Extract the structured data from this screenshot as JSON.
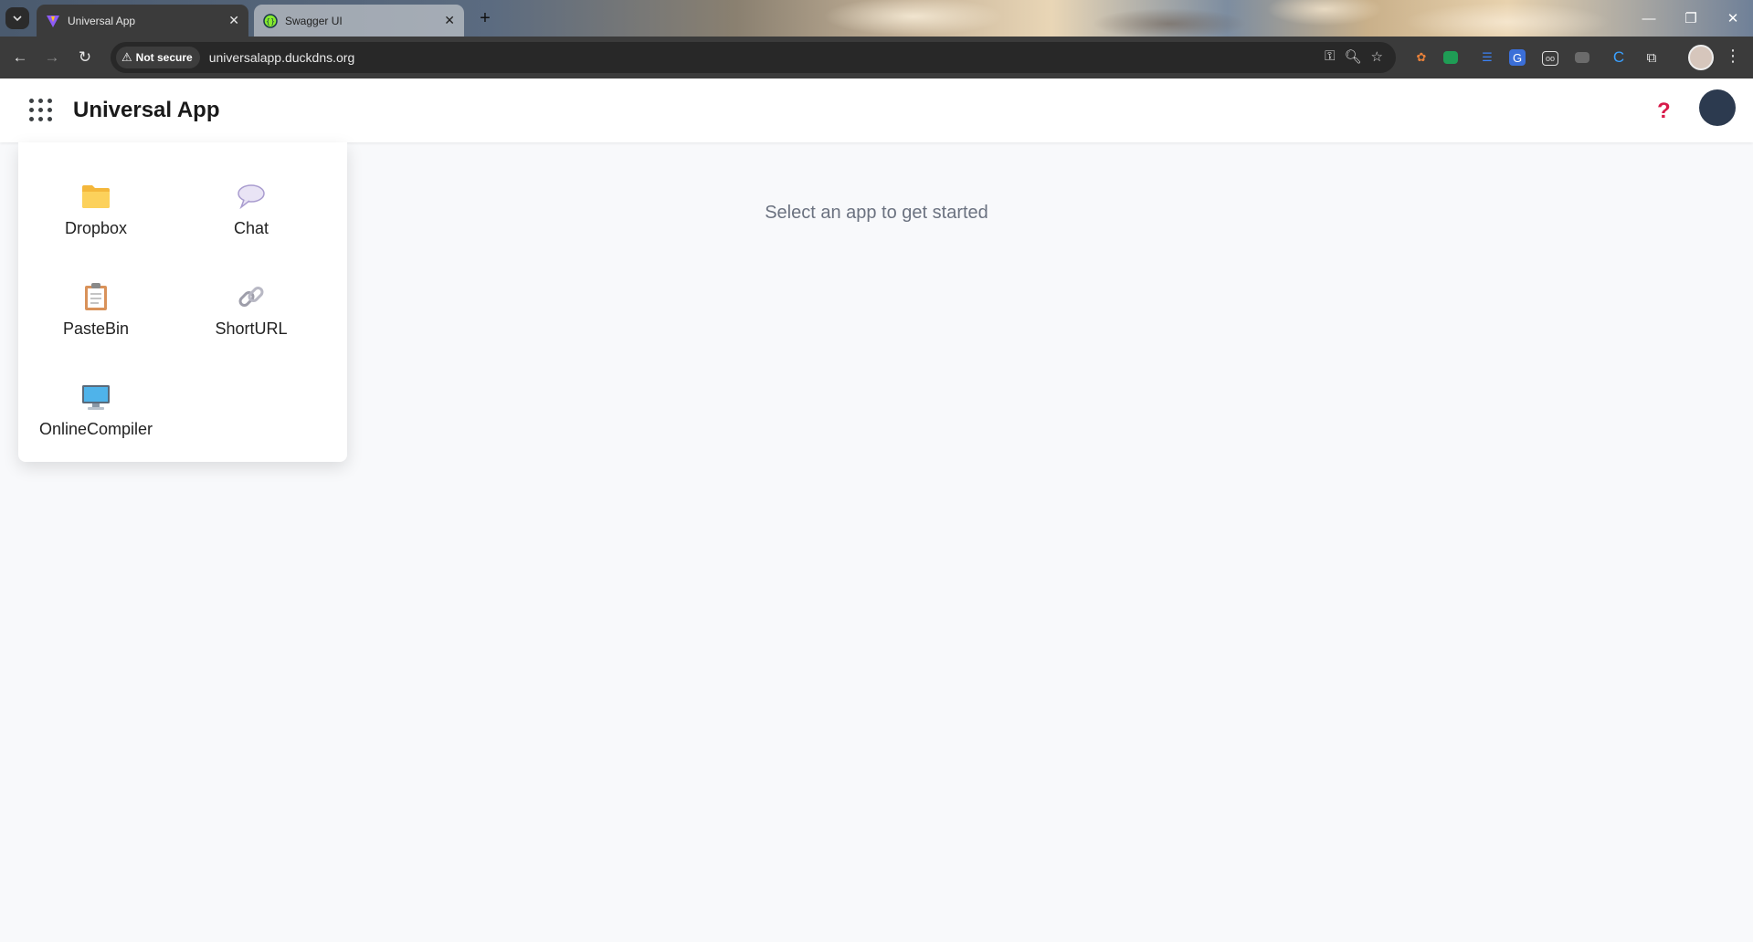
{
  "browser": {
    "tabs": [
      {
        "title": "Universal App",
        "active": true
      },
      {
        "title": "Swagger UI",
        "active": false
      }
    ],
    "security_label": "Not secure",
    "url": "universalapp.duckdns.org"
  },
  "header": {
    "title": "Universal App",
    "help_glyph": "?"
  },
  "launcher": {
    "apps": [
      {
        "label": "Dropbox",
        "icon": "folder-icon"
      },
      {
        "label": "Chat",
        "icon": "speech-bubble-icon"
      },
      {
        "label": "PasteBin",
        "icon": "clipboard-icon"
      },
      {
        "label": "ShortURL",
        "icon": "link-icon"
      },
      {
        "label": "OnlineCompiler",
        "icon": "desktop-computer-icon"
      }
    ]
  },
  "main": {
    "empty_message": "Select an app to get started"
  },
  "colors": {
    "accent_help": "#d81b4a",
    "avatar": "#2c3a4f"
  }
}
